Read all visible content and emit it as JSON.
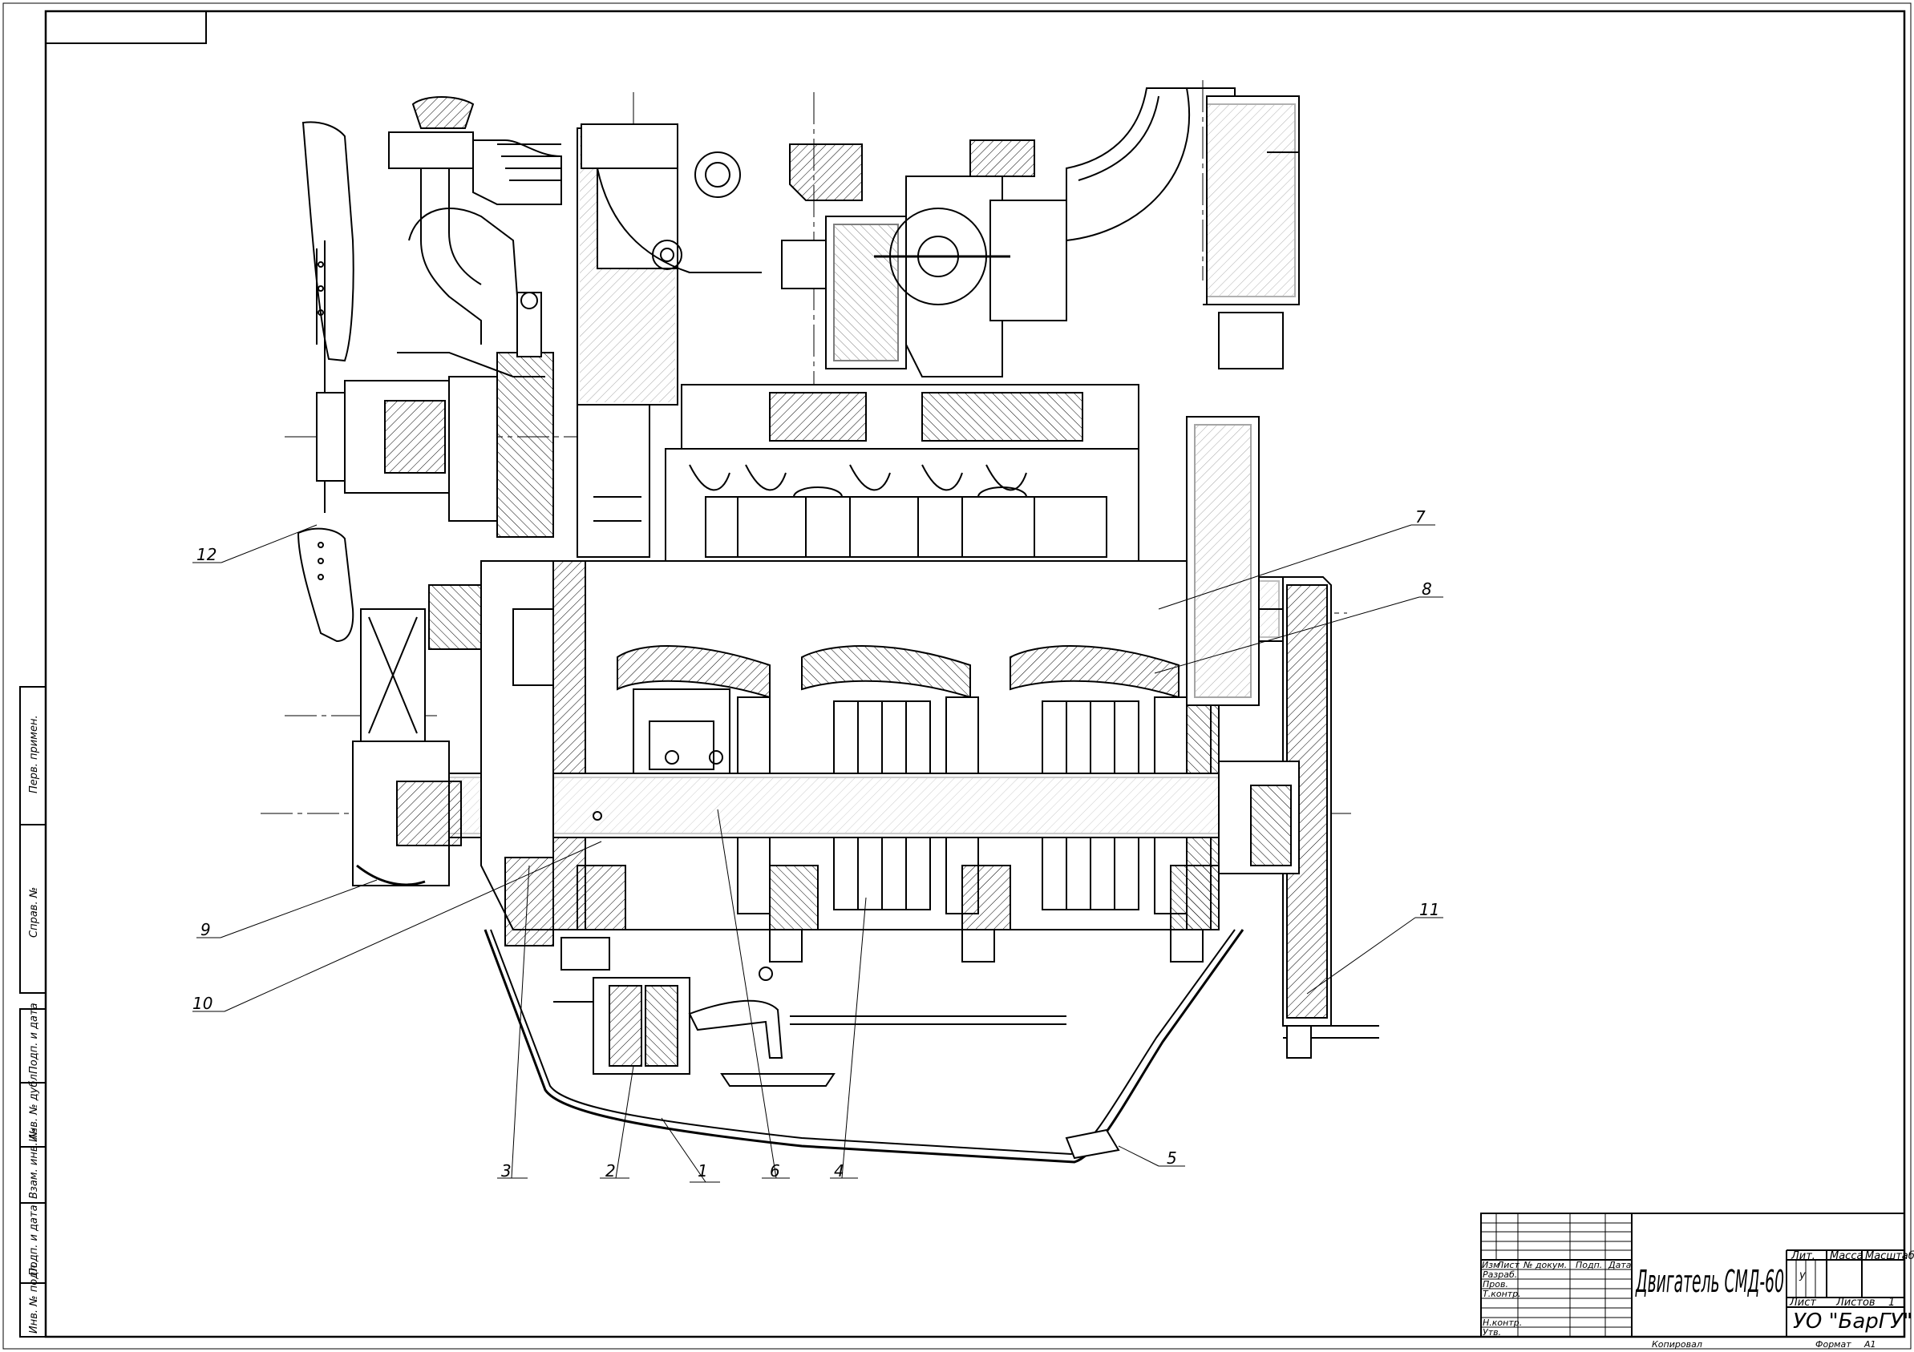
{
  "drawing": {
    "title": "Двигатель СМД-60",
    "organization": "УО \"БарГУ\"",
    "sheet_number": "1",
    "mass_letter": "у"
  },
  "callouts": [
    {
      "id": "1",
      "text": "1"
    },
    {
      "id": "2",
      "text": "2"
    },
    {
      "id": "3",
      "text": "3"
    },
    {
      "id": "4",
      "text": "4"
    },
    {
      "id": "5",
      "text": "5"
    },
    {
      "id": "6",
      "text": "6"
    },
    {
      "id": "7",
      "text": "7"
    },
    {
      "id": "8",
      "text": "8"
    },
    {
      "id": "9",
      "text": "9"
    },
    {
      "id": "10",
      "text": "10"
    },
    {
      "id": "11",
      "text": "11"
    },
    {
      "id": "12",
      "text": "12"
    }
  ],
  "title_block": {
    "col_izm": "Изм",
    "col_list": "Лист",
    "col_doc": "№ докум.",
    "col_sign": "Подп.",
    "col_date": "Дата",
    "razrab": "Разраб.",
    "prov": "Пров.",
    "tkontr": "Т.контр.",
    "nkontr": "Н.контр.",
    "utv": "Утв.",
    "lit": "Лит.",
    "massa": "Масса",
    "masshtab": "Масштаб",
    "list_label": "Лист",
    "listov_label": "Листов",
    "kopiroval": "Копировал",
    "format_label": "Формат",
    "format_value": "А1"
  },
  "side_stamp": {
    "perv_primen": "Перв. примен.",
    "sprav_no": "Справ. №",
    "podp_data_1": "Подп. и дата",
    "inv_dubl": "Инв. № дубл.",
    "vzam_inv": "Взам. инв. №",
    "podp_data_2": "Подп. и дата",
    "inv_podl": "Инв. № подл."
  }
}
